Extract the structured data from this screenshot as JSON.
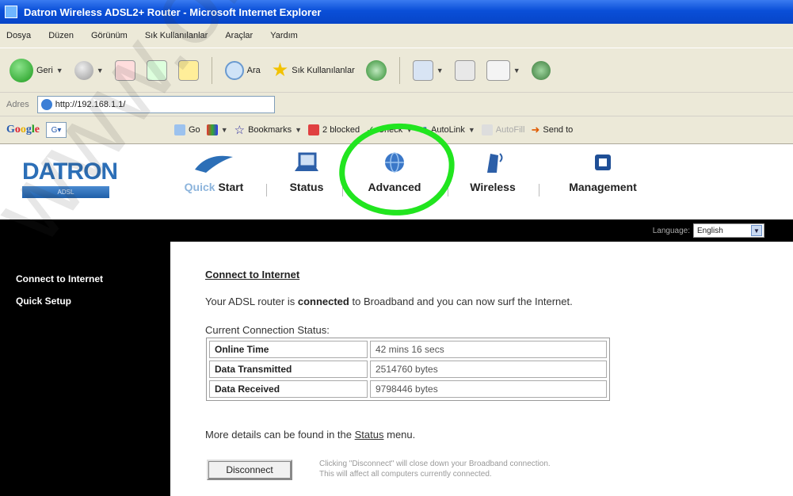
{
  "window": {
    "title": "Datron Wireless ADSL2+ Router - Microsoft Internet Explorer"
  },
  "menu": [
    "Dosya",
    "Düzen",
    "Görünüm",
    "Sık Kullanılanlar",
    "Araçlar",
    "Yardım"
  ],
  "toolbar": {
    "back_label": "Geri",
    "search_label": "Ara",
    "favorites_label": "Sık Kullanılanlar"
  },
  "address": {
    "label": "Adres",
    "url": "http://192.168.1.1/"
  },
  "google_bar": {
    "go_label": "Go",
    "bookmarks_label": "Bookmarks",
    "blocked_label": "2 blocked",
    "check_label": "Check",
    "autolink_label": "AutoLink",
    "autofill_label": "AutoFill",
    "sendto_label": "Send to"
  },
  "router": {
    "brand_name": "DATRON",
    "brand_tag": "ADSL",
    "nav": {
      "quick_start": "Start",
      "status": "Status",
      "advanced": "Advanced",
      "wireless": "Wireless",
      "management": "Management"
    },
    "language_label": "Language:",
    "language_value": "English",
    "sidebar": [
      "Connect to Internet",
      "Quick Setup"
    ],
    "content": {
      "title": "Connect to Internet",
      "status_prefix": "Your ADSL router is",
      "status_bold": "connected",
      "status_suffix": "to Broadband and you can now surf the Internet.",
      "ccs_label": "Current Connection Status:",
      "rows": [
        {
          "key": "Online Time",
          "value": "42 mins 16 secs"
        },
        {
          "key": "Data Transmitted",
          "value": "2514760 bytes"
        },
        {
          "key": "Data Received",
          "value": "9798446 bytes"
        }
      ],
      "more_prefix": "More details can be found in the",
      "more_link": "Status",
      "more_suffix": "menu.",
      "disconnect_label": "Disconnect",
      "disconnect_note_1": "Clicking \"Disconnect\" will close down your Broadband connection.",
      "disconnect_note_2": "This will affect all computers currently connected."
    }
  },
  "watermark": "www.ondu"
}
